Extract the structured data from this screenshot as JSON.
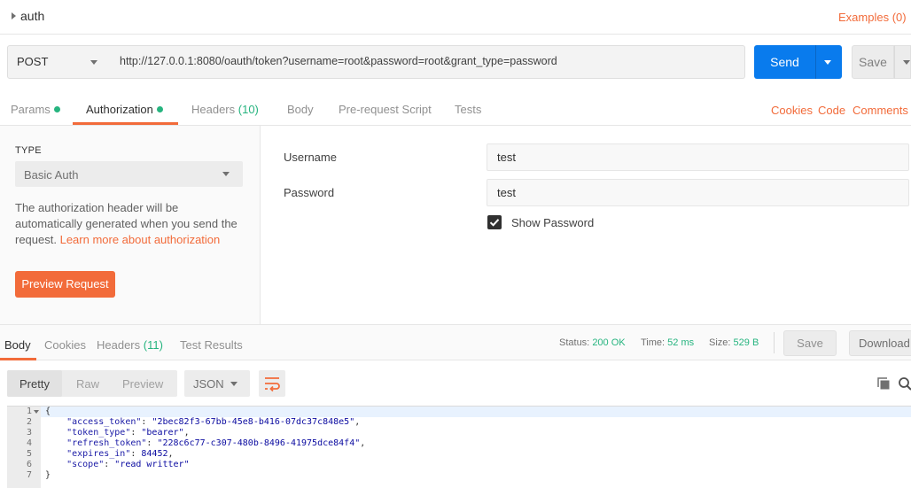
{
  "request": {
    "name": "auth",
    "examples_label": "Examples (0)",
    "method": "POST",
    "url": "http://127.0.0.1:8080/oauth/token?username=root&password=root&grant_type=password",
    "send_label": "Send",
    "save_label": "Save"
  },
  "request_tabs": {
    "params": "Params",
    "authorization": "Authorization",
    "headers": "Headers",
    "headers_count": "(10)",
    "body": "Body",
    "prerequest": "Pre-request Script",
    "tests": "Tests",
    "cookies": "Cookies",
    "code": "Code",
    "comments": "Comments ("
  },
  "auth": {
    "type_label": "TYPE",
    "type_value": "Basic Auth",
    "desc_part1": "The authorization header will be automatically generated when you send the request. ",
    "desc_link": "Learn more about authorization",
    "preview_label": "Preview Request",
    "username_label": "Username",
    "username_value": "test",
    "password_label": "Password",
    "password_value": "test",
    "show_password_label": "Show Password",
    "show_password_checked": true
  },
  "response_tabs": {
    "body": "Body",
    "cookies": "Cookies",
    "headers": "Headers",
    "headers_count": "(11)",
    "test_results": "Test Results"
  },
  "response_status": {
    "status_label": "Status:",
    "status_value": "200 OK",
    "time_label": "Time:",
    "time_value": "52 ms",
    "size_label": "Size:",
    "size_value": "529 B",
    "save_label": "Save",
    "download_label": "Download"
  },
  "response_view": {
    "pretty": "Pretty",
    "raw": "Raw",
    "preview": "Preview",
    "format": "JSON"
  },
  "response_body": {
    "line_numbers": [
      "1",
      "2",
      "3",
      "4",
      "5",
      "6",
      "7"
    ],
    "open_brace": "{",
    "close_brace": "}",
    "fields": [
      {
        "key": "\"access_token\"",
        "value": "\"2bec82f3-67bb-45e8-b416-07dc37c848e5\"",
        "comma": ","
      },
      {
        "key": "\"token_type\"",
        "value": "\"bearer\"",
        "comma": ","
      },
      {
        "key": "\"refresh_token\"",
        "value": "\"228c6c77-c307-480b-8496-41975dce84f4\"",
        "comma": ","
      },
      {
        "key": "\"expires_in\"",
        "value": "84452",
        "comma": ","
      },
      {
        "key": "\"scope\"",
        "value": "\"read writter\"",
        "comma": ""
      }
    ]
  },
  "colors": {
    "accent": "#f26b3a",
    "primary": "#097bed",
    "success": "#26b47f"
  },
  "icons": [
    "caret-right-icon",
    "chevron-down-icon",
    "wrap-lines-icon",
    "copy-icon",
    "search-icon",
    "checkbox-checked-icon"
  ]
}
